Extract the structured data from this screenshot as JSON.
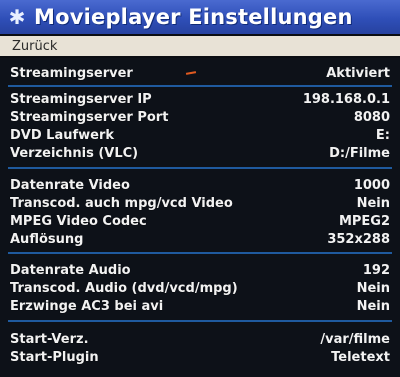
{
  "header": {
    "title": "Movieplayer Einstellungen",
    "icon": "asterisk-icon"
  },
  "back": {
    "label": "Zurück"
  },
  "settings": [
    {
      "label": "Streamingserver",
      "value": "Aktiviert"
    },
    {
      "label": "Streamingserver IP",
      "value": "198.168.0.1"
    },
    {
      "label": "Streamingserver Port",
      "value": "8080"
    },
    {
      "label": "DVD Laufwerk",
      "value": "E:"
    },
    {
      "label": "Verzeichnis (VLC)",
      "value": "D:/Filme"
    },
    {
      "label": "Datenrate Video",
      "value": "1000"
    },
    {
      "label": "Transcod. auch mpg/vcd Video",
      "value": "Nein"
    },
    {
      "label": "MPEG Video Codec",
      "value": "MPEG2"
    },
    {
      "label": "Auflösung",
      "value": "352x288"
    },
    {
      "label": "Datenrate Audio",
      "value": "192"
    },
    {
      "label": "Transcod. Audio (dvd/vcd/mpg)",
      "value": "Nein"
    },
    {
      "label": "Erzwinge AC3 bei avi",
      "value": "Nein"
    },
    {
      "label": "Start-Verz.",
      "value": "/var/filme"
    },
    {
      "label": "Start-Plugin",
      "value": "Teletext"
    }
  ],
  "colors": {
    "title_bar": "#3557c0",
    "back_bar": "#e8e2d6",
    "separator": "#1f5a9e",
    "background": "#0d1118",
    "text": "#f2f2f2"
  }
}
